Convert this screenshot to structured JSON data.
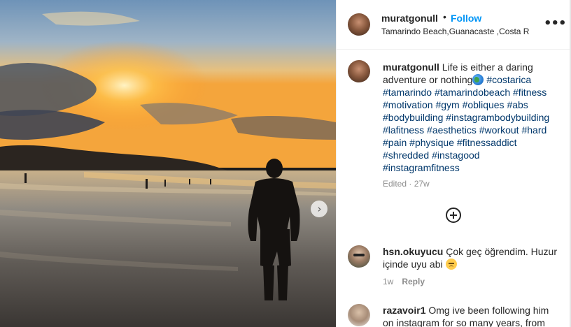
{
  "post": {
    "username": "muratgonull",
    "separator": "•",
    "follow_label": "Follow",
    "location": "Tamarindo Beach,Guanacaste ,Costa R",
    "more_icon": "more-horizontal-icon",
    "more_label": "•••"
  },
  "caption": {
    "username": "muratgonull",
    "text": "Life is either a daring adventure or nothing",
    "emoji": "globe-emoji",
    "hashtags": [
      "#costarica",
      "#tamarindo",
      "#tamarindobeach",
      "#fitness",
      "#motivation",
      "#gym",
      "#obliques",
      "#abs",
      "#bodybuilding",
      "#instagrambodybuilding",
      "#lafitness",
      "#aesthetics",
      "#workout",
      "#hard",
      "#pain",
      "#physique",
      "#fitnessaddict",
      "#shredded",
      "#instagood",
      "#instagramfitness"
    ],
    "meta": "Edited · 27w"
  },
  "load_more_icon": "add-circle-icon",
  "comments": [
    {
      "username": "hsn.okuyucu",
      "text": "Çok geç öğrendim. Huzur içinde uyu abi",
      "emoji": "pensive-face-emoji",
      "time": "1w",
      "reply_label": "Reply"
    },
    {
      "username": "razavoir1",
      "text": "Omg ive been following him on instagram for so many years, from"
    }
  ],
  "carousel": {
    "next_icon": "chevron-right-icon",
    "next_glyph": "›"
  },
  "colors": {
    "link": "#0095f6",
    "hashtag": "#00376b",
    "muted": "#8e8e8e",
    "text": "#262626"
  }
}
